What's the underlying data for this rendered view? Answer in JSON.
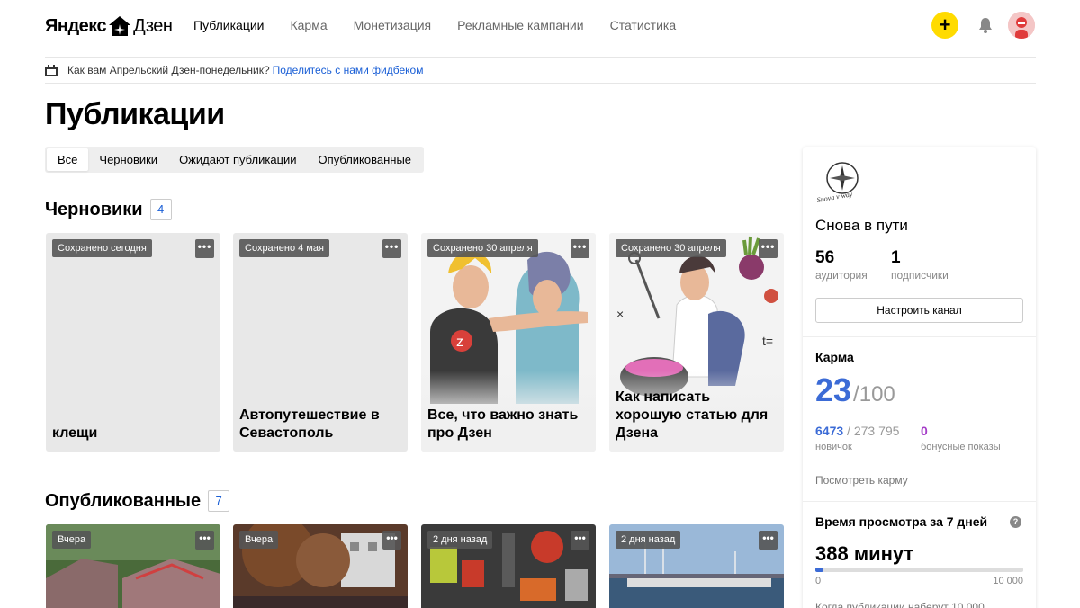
{
  "header": {
    "logo_left": "Яндекс",
    "logo_right": "Дзен",
    "nav": [
      {
        "label": "Публикации",
        "active": true
      },
      {
        "label": "Карма",
        "active": false
      },
      {
        "label": "Монетизация",
        "active": false
      },
      {
        "label": "Рекламные кампании",
        "active": false
      },
      {
        "label": "Статистика",
        "active": false
      }
    ],
    "plus": "+"
  },
  "notice": {
    "text": "Как вам Апрельский Дзен-понедельник?",
    "link": "Поделитесь с нами фидбеком"
  },
  "page_title": "Публикации",
  "tabs": [
    {
      "label": "Все",
      "active": true
    },
    {
      "label": "Черновики",
      "active": false
    },
    {
      "label": "Ожидают публикации",
      "active": false
    },
    {
      "label": "Опубликованные",
      "active": false
    }
  ],
  "drafts": {
    "title": "Черновики",
    "count": "4",
    "items": [
      {
        "badge": "Сохранено сегодня",
        "title": "клещи"
      },
      {
        "badge": "Сохранено 4 мая",
        "title": "Автопутешествие в Севастополь"
      },
      {
        "badge": "Сохранено 30 апреля",
        "title": "Все, что важно знать про Дзен"
      },
      {
        "badge": "Сохранено 30 апреля",
        "title": "Как написать хорошую статью для Дзена"
      }
    ]
  },
  "published": {
    "title": "Опубликованные",
    "count": "7",
    "items": [
      {
        "badge": "Вчера"
      },
      {
        "badge": "Вчера"
      },
      {
        "badge": "2 дня назад"
      },
      {
        "badge": "2 дня назад"
      }
    ]
  },
  "dots": "•••",
  "channel": {
    "logo_text": "Snova v way",
    "name": "Снова в пути",
    "audience": "56",
    "audience_label": "аудитория",
    "subscribers": "1",
    "subscribers_label": "подписчики",
    "setup_button": "Настроить канал"
  },
  "karma": {
    "heading": "Карма",
    "value": "23",
    "max": "/100",
    "rank_num": "6473",
    "rank_total": " / 273 795",
    "rank_label": "новичок",
    "bonus": "0",
    "bonus_label": "бонусные показы",
    "link": "Посмотреть карму"
  },
  "view_time": {
    "heading": "Время просмотра за 7 дней",
    "help": "?",
    "value": "388 минут",
    "progress": 0.0388,
    "min_label": "0",
    "max_label": "10 000",
    "note": "Когда публикации наберут 10 000"
  },
  "colors": {
    "accent": "#3b6bd6",
    "plus": "#ffdb00",
    "bonus": "#a53dc8"
  }
}
